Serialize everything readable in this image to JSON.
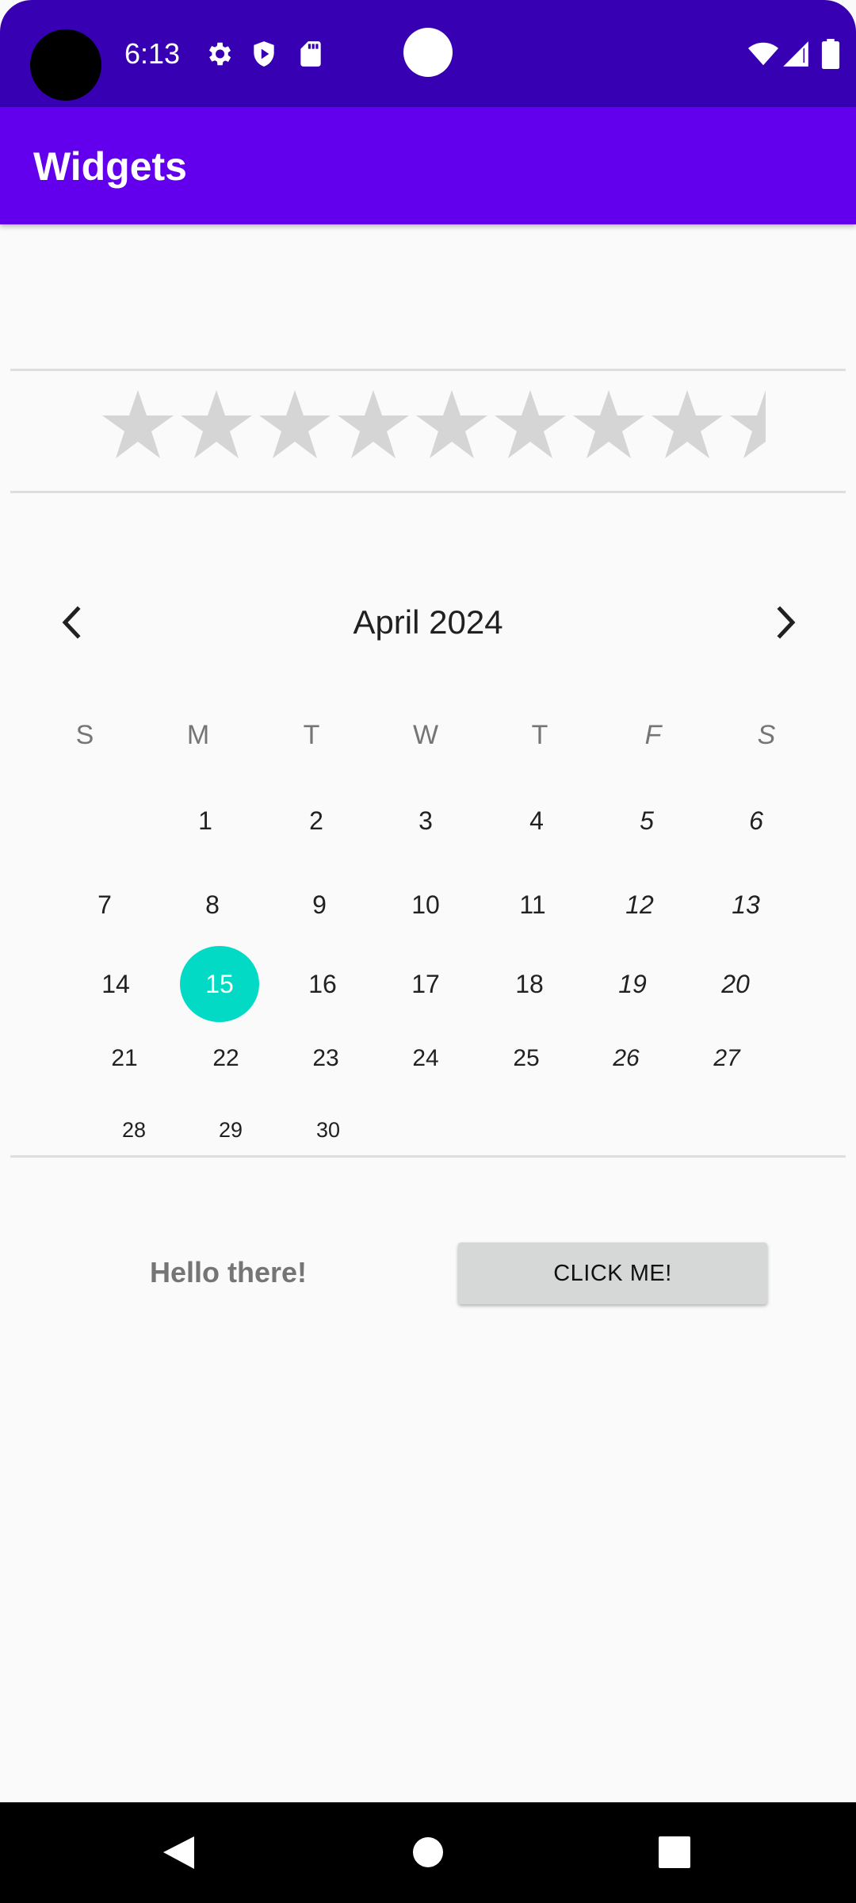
{
  "status_bar": {
    "time": "6:13",
    "icons": [
      "settings-icon",
      "shield-icon",
      "sd-card-icon",
      "wifi-icon",
      "signal-icon",
      "battery-icon"
    ]
  },
  "app_bar": {
    "title": "Widgets"
  },
  "rating": {
    "max_stars": 9,
    "value": 0
  },
  "calendar": {
    "month_label": "April 2024",
    "days_of_week": [
      "S",
      "M",
      "T",
      "W",
      "T",
      "F",
      "S"
    ],
    "selected_day": "15",
    "weeks": [
      [
        "",
        "1",
        "2",
        "3",
        "4",
        "5",
        "6"
      ],
      [
        "7",
        "8",
        "9",
        "10",
        "11",
        "12",
        "13"
      ],
      [
        "14",
        "15",
        "16",
        "17",
        "18",
        "19",
        "20"
      ],
      [
        "21",
        "22",
        "23",
        "24",
        "25",
        "26",
        "27"
      ],
      [
        "28",
        "29",
        "30"
      ]
    ]
  },
  "greeting": {
    "text": "Hello there!"
  },
  "button": {
    "label": "CLICK ME!"
  },
  "colors": {
    "status_bar": "#3700b3",
    "app_bar": "#6200ee",
    "selected_day": "#03dac5",
    "button_bg": "#d6d7d7"
  }
}
